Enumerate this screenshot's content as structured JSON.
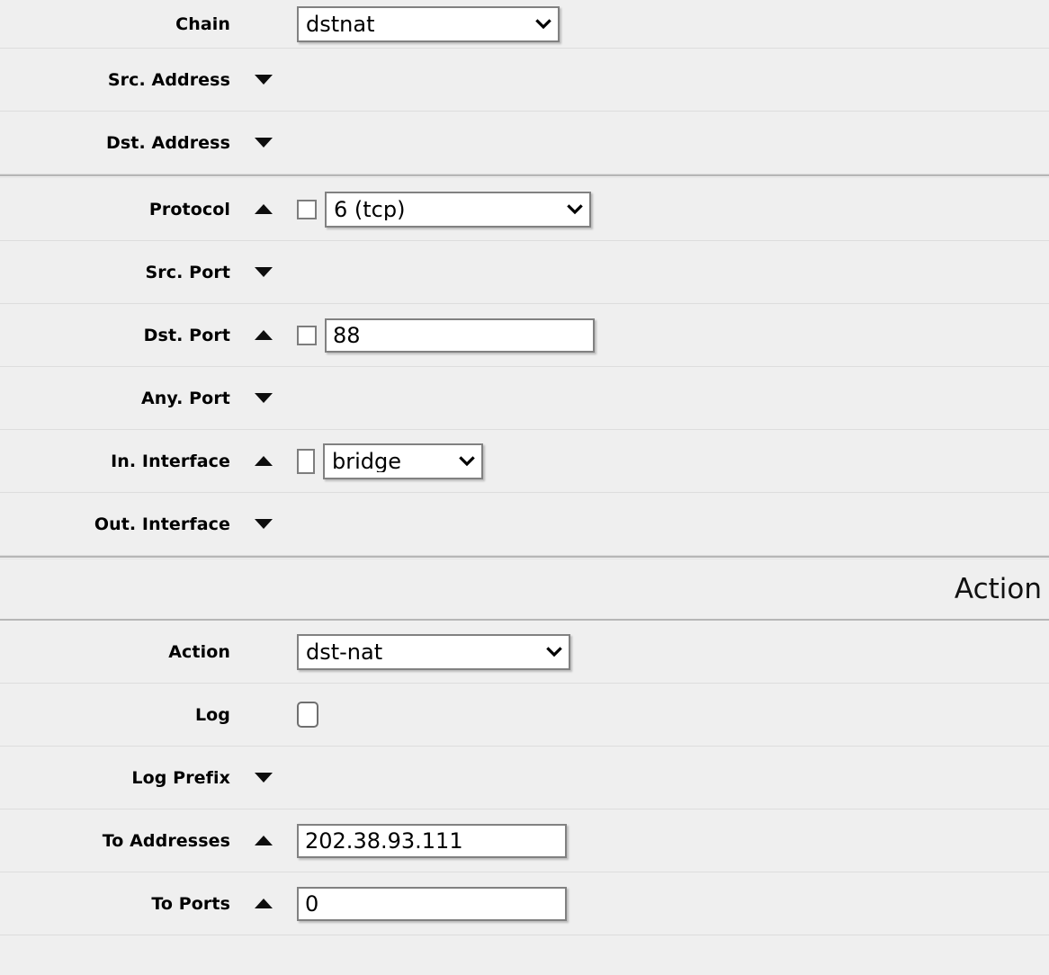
{
  "sections": [
    {
      "id": "matchers",
      "rows": [
        {
          "label": "Chain",
          "toggle": "none",
          "control": "select",
          "value": "dstnat",
          "checkbox": "none"
        },
        {
          "label": "Src. Address",
          "toggle": "down",
          "control": "none",
          "value": "",
          "checkbox": "none"
        },
        {
          "label": "Dst. Address",
          "toggle": "down",
          "control": "none",
          "value": "",
          "checkbox": "none"
        },
        {
          "label": "Protocol",
          "toggle": "up",
          "control": "select",
          "value": "6 (tcp)",
          "checkbox": "square"
        },
        {
          "label": "Src. Port",
          "toggle": "down",
          "control": "none",
          "value": "",
          "checkbox": "none"
        },
        {
          "label": "Dst. Port",
          "toggle": "up",
          "control": "text",
          "value": "88",
          "checkbox": "square"
        },
        {
          "label": "Any. Port",
          "toggle": "down",
          "control": "none",
          "value": "",
          "checkbox": "none"
        },
        {
          "label": "In. Interface",
          "toggle": "up",
          "control": "select",
          "value": "bridge",
          "checkbox": "tall"
        },
        {
          "label": "Out. Interface",
          "toggle": "down",
          "control": "none",
          "value": "",
          "checkbox": "none"
        }
      ]
    },
    {
      "id": "action",
      "header": "Action",
      "rows": [
        {
          "label": "Action",
          "toggle": "none",
          "control": "select",
          "value": "dst-nat",
          "checkbox": "none"
        },
        {
          "label": "Log",
          "toggle": "none",
          "control": "none",
          "value": "",
          "checkbox": "rounded"
        },
        {
          "label": "Log Prefix",
          "toggle": "down",
          "control": "none",
          "value": "",
          "checkbox": "none"
        },
        {
          "label": "To Addresses",
          "toggle": "up",
          "control": "text",
          "value": "202.38.93.111",
          "checkbox": "none"
        },
        {
          "label": "To Ports",
          "toggle": "up",
          "control": "text",
          "value": "0",
          "checkbox": "none"
        }
      ]
    }
  ],
  "icons": {
    "chevron_down": "chevron-down-icon",
    "triangle_down": "triangle-down-icon",
    "triangle_up": "triangle-up-icon"
  },
  "colors": {
    "background": "#efefef",
    "row_divider": "#dddddd",
    "section_divider": "#b6b6b6",
    "control_border": "#818181",
    "control_fill": "#ffffff",
    "text": "#000000"
  }
}
